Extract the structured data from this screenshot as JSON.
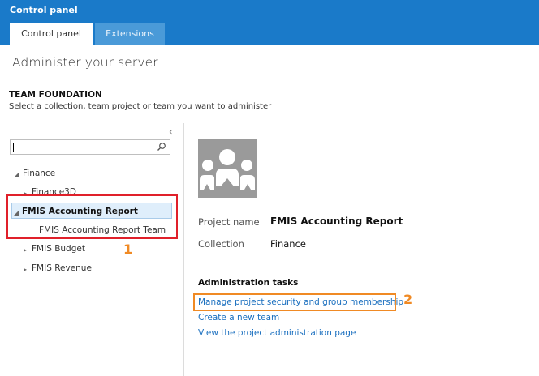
{
  "header": {
    "title": "Control panel"
  },
  "tabs": [
    {
      "label": "Control panel",
      "active": true
    },
    {
      "label": "Extensions",
      "active": false
    }
  ],
  "page": {
    "title": "Administer your server",
    "section_title": "TEAM FOUNDATION",
    "section_subtitle": "Select a collection, team project or team you want to administer"
  },
  "search": {
    "value": "",
    "placeholder": ""
  },
  "tree": {
    "collection": "Finance",
    "projects": [
      {
        "label": "Finance3D",
        "expanded": false
      },
      {
        "label": "FMIS Accounting Report",
        "expanded": true,
        "selected": true,
        "teams": [
          "FMIS Accounting Report Team"
        ]
      },
      {
        "label": "FMIS Budget",
        "expanded": false
      },
      {
        "label": "FMIS Revenue",
        "expanded": false
      }
    ]
  },
  "details": {
    "project_name_label": "Project name",
    "project_name_value": "FMIS Accounting Report",
    "collection_label": "Collection",
    "collection_value": "Finance"
  },
  "admin": {
    "title": "Administration tasks",
    "links": [
      "Manage project security and group membership",
      "Create a new team",
      "View the project administration page"
    ]
  },
  "annotations": {
    "step1": "1",
    "step2": "2"
  },
  "colors": {
    "header": "#1a7ac9",
    "link": "#1a6fbf",
    "highlight_red": "#e0202a",
    "highlight_orange": "#f08a24",
    "selected_bg": "#dfeefb"
  }
}
